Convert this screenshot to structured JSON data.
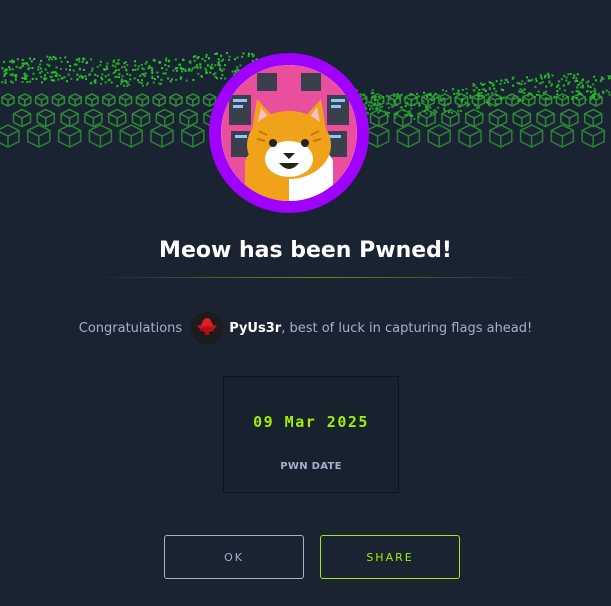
{
  "modal": {
    "title": "Meow has been Pwned!",
    "congrats_prefix": "Congratulations",
    "username": "PyUs3r",
    "congrats_suffix": ", best of luck in capturing flags ahead!",
    "pwn_date": "09 Mar 2025",
    "pwn_date_label": "PWN DATE",
    "ok_label": "OK",
    "share_label": "SHARE"
  },
  "colors": {
    "background": "#1a2332",
    "accent_green": "#9fef00",
    "avatar_ring": "#9f00ff",
    "muted_text": "#a4b1cd"
  },
  "icons": {
    "banner": "green-cube-wave",
    "machine_avatar": "cat-face",
    "user_avatar": "red-hat-hacker"
  }
}
